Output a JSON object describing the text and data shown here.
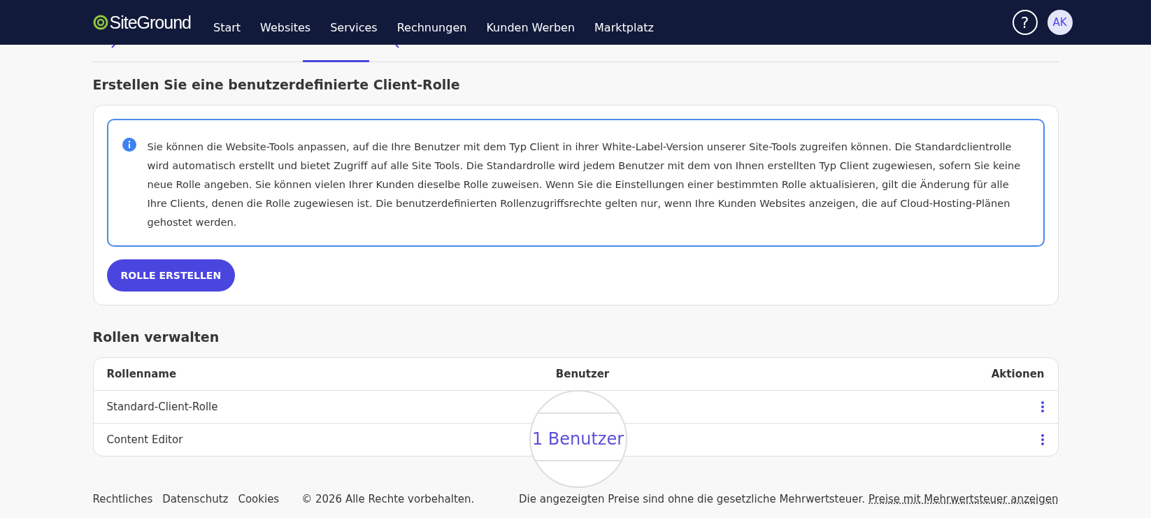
{
  "brand": {
    "name": "SiteGround"
  },
  "nav": {
    "items": [
      {
        "label": "Start",
        "selected": false
      },
      {
        "label": "Websites",
        "selected": false
      },
      {
        "label": "Services",
        "selected": false
      },
      {
        "label": "Rechnungen",
        "selected": false
      },
      {
        "label": "Kunden Werben",
        "selected": false
      },
      {
        "label": "Marktplatz",
        "selected": false
      }
    ],
    "help": "?",
    "avatar": "AK"
  },
  "create": {
    "title": "Erstellen Sie eine benutzerdefinierte Client-Rolle",
    "info": "Sie können die Website-Tools anpassen, auf die Ihre Benutzer mit dem Typ Client in ihrer White-Label-Version unserer Site-Tools zugreifen können. Die Standardclientrolle wird automatisch erstellt und bietet Zugriff auf alle Site Tools. Die Standardrolle wird jedem Benutzer mit dem von Ihnen erstellten Typ Client zugewiesen, sofern Sie keine neue Rolle angeben. Sie können vielen Ihrer Kunden dieselbe Rolle zuweisen. Wenn Sie die Einstellungen einer bestimmten Rolle aktualisieren, gilt die Änderung für alle Ihre Clients, denen die Rolle zugewiesen ist. Die benutzerdefinierten Rollenzugriffsrechte gelten nur, wenn Ihre Kunden Websites anzeigen, die auf Cloud-Hosting-Plänen gehostet werden.",
    "button": "ROLLE ERSTELLEN"
  },
  "roles": {
    "title": "Rollen verwalten",
    "columns": [
      "Rollenname",
      "Benutzer",
      "Aktionen"
    ],
    "rows": [
      {
        "name": "Standard-Client-Rolle"
      },
      {
        "name": "Content Editor"
      }
    ],
    "magnifier": "1 Benutzer"
  },
  "footer": {
    "links": [
      "Rechtliches",
      "Datenschutz",
      "Cookies"
    ],
    "copyright": "© 2026 Alle Rechte vorbehalten.",
    "note": "Die angezeigten Preise sind ohne die gesetzliche Mehrwertsteuer.",
    "link": "Preise mit Mehrwertsteuer anzeigen"
  }
}
